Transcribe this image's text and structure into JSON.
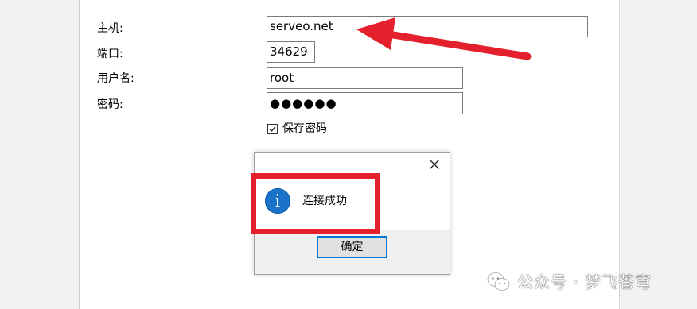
{
  "form": {
    "host_label": "主机:",
    "host_value": "serveo.net",
    "port_label": "端口:",
    "port_value": "34629",
    "username_label": "用户名:",
    "username_value": "root",
    "password_label": "密码:",
    "password_value": "●●●●●●",
    "save_password_label": "保存密码",
    "save_password_checked": true
  },
  "dialog": {
    "close_icon": "close-icon",
    "info_icon": "info-icon",
    "info_glyph": "i",
    "message": "连接成功",
    "ok_label": "确定"
  },
  "annotations": {
    "arrow_color": "#e3202b",
    "box_color": "#e3202b"
  },
  "watermark": {
    "icon": "wechat-icon",
    "text": "公众号 · 梦飞苍穹"
  }
}
